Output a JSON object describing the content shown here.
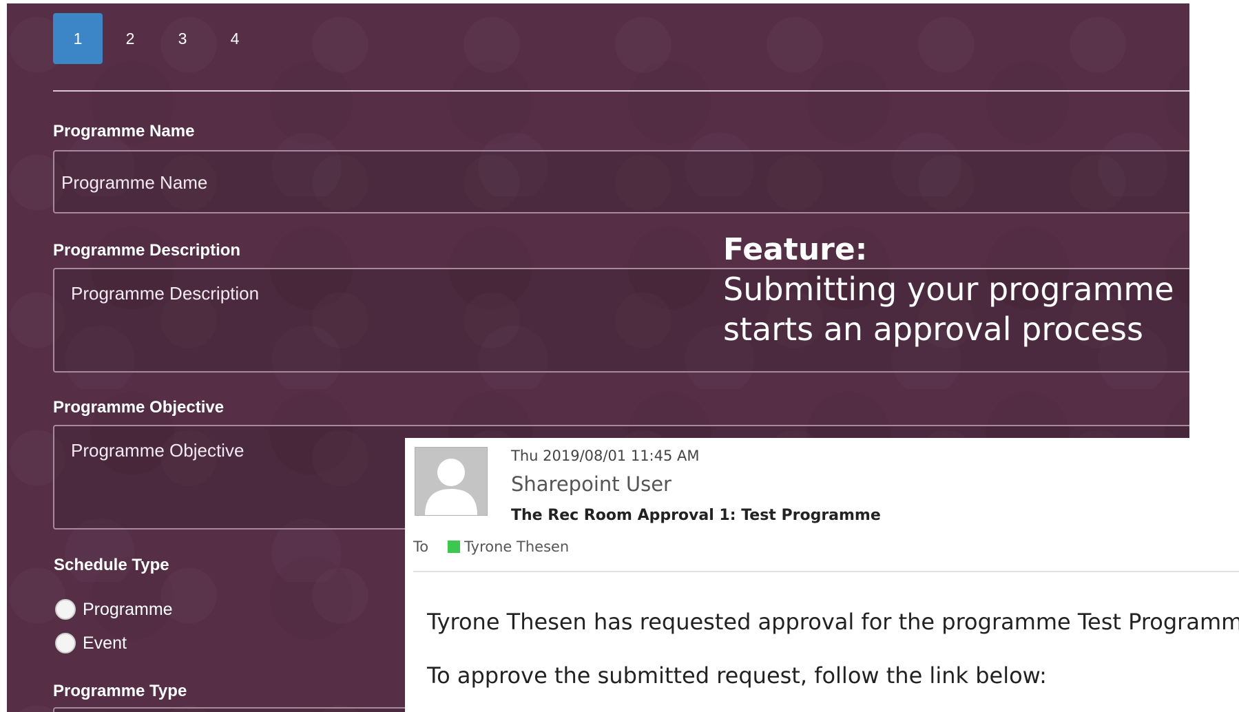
{
  "pagination": {
    "pages": [
      "1",
      "2",
      "3",
      "4"
    ],
    "active": "1"
  },
  "form": {
    "programme_name": {
      "label": "Programme Name",
      "placeholder": "Programme Name"
    },
    "programme_description": {
      "label": "Programme Description",
      "placeholder": "Programme Description"
    },
    "programme_objective": {
      "label": "Programme Objective",
      "placeholder": "Programme Objective"
    },
    "schedule_type": {
      "label": "Schedule Type",
      "options": [
        "Programme",
        "Event"
      ]
    },
    "programme_type": {
      "label": "Programme Type"
    }
  },
  "feature": {
    "title": "Feature:",
    "body": "Submitting your programme starts an approval process"
  },
  "email": {
    "date": "Thu 2019/08/01 11:45 AM",
    "sender": "Sharepoint User",
    "subject": "The Rec Room Approval 1: Test Programme",
    "to_label": "To",
    "recipient": "Tyrone Thesen",
    "presence_color": "#3cc84f",
    "body_line1": "Tyrone Thesen has requested approval for the programme Test Programme",
    "body_line2": "To approve the submitted request, follow the link below:"
  },
  "colors": {
    "panel_bg": "#562f47",
    "active_page": "#3c85c6"
  }
}
